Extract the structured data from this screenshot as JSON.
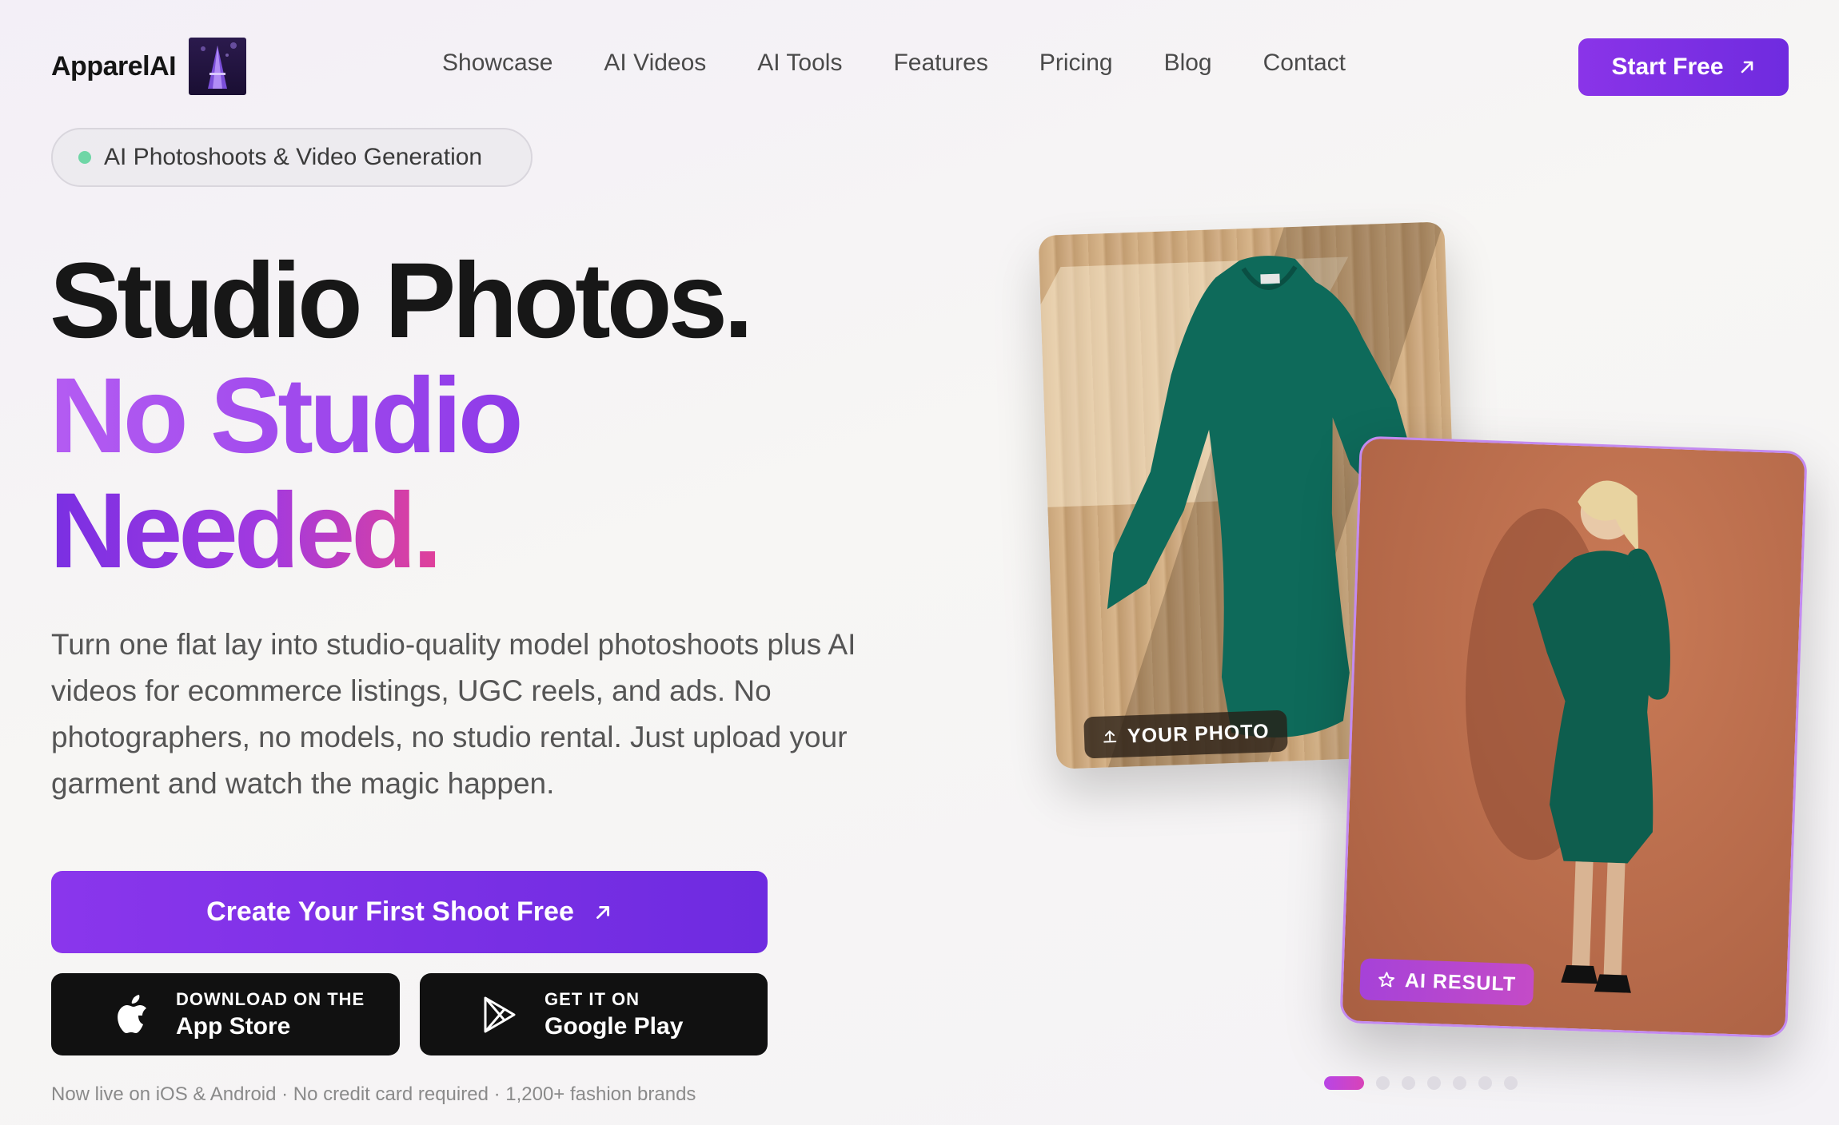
{
  "brand": {
    "name": "ApparelAI"
  },
  "nav": {
    "items": [
      "Showcase",
      "AI Videos",
      "AI Tools",
      "Features",
      "Pricing",
      "Blog",
      "Contact"
    ],
    "cta": "Start Free"
  },
  "badge": {
    "text": "AI Photoshoots & Video Generation"
  },
  "hero": {
    "line1": "Studio Photos.",
    "line2": "No Studio",
    "line3": "Needed.",
    "description": "Turn one flat lay into studio-quality model photoshoots plus AI videos for ecommerce listings, UGC reels, and ads. No photographers, no models, no studio rental. Just upload your garment and watch the magic happen.",
    "cta": "Create Your First Shoot Free",
    "app_store": {
      "small": "DOWNLOAD ON THE",
      "big": "App Store"
    },
    "google_play": {
      "small": "GET IT ON",
      "big": "Google Play"
    },
    "footnote": "Now live on iOS & Android · No credit card required · 1,200+ fashion brands"
  },
  "cards": {
    "before_label": "YOUR PHOTO",
    "after_label": "AI RESULT"
  },
  "carousel": {
    "count": 7,
    "active": 0
  },
  "colors": {
    "accent": "#7c30e4",
    "accent_pink": "#e0409a",
    "status_dot": "#6fd6a6"
  }
}
